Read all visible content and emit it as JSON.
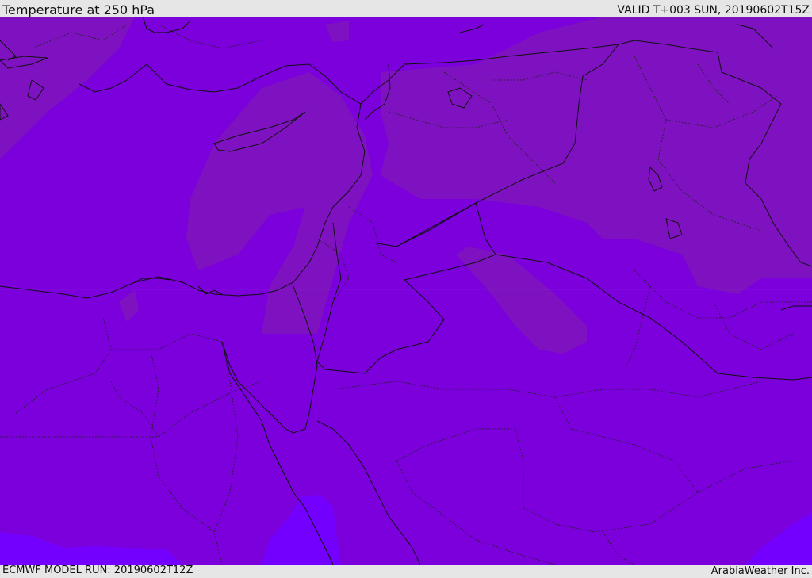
{
  "header": {
    "title": "Temperature at 250 hPa",
    "valid": "VALID T+003 SUN, 20190602T15Z"
  },
  "footer": {
    "model_run": "ECMWF MODEL RUN: 20190602T12Z",
    "credit": "ArabiaWeather Inc."
  },
  "colors": {
    "base_fill": "#7b00dc",
    "warm_patch": "#7e12c0",
    "cold_patch": "#7300ff",
    "border": "#111111",
    "frame": "#e6e6e6"
  }
}
